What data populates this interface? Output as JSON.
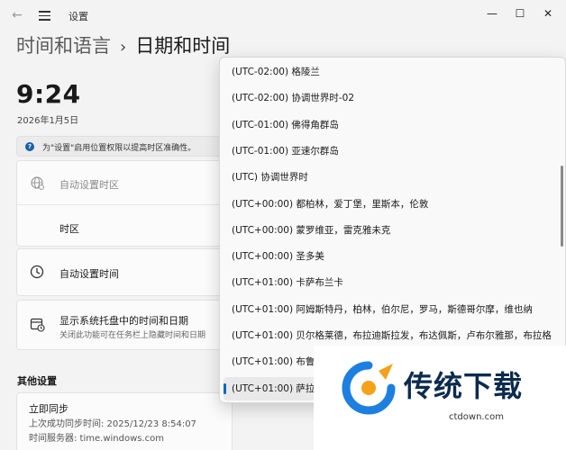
{
  "window": {
    "title": "设置"
  },
  "breadcrumb": {
    "parent": "时间和语言",
    "separator": "›",
    "current": "日期和时间"
  },
  "clock": {
    "time": "9:24",
    "date": "2026年1月5日"
  },
  "infobar": {
    "icon_glyph": "?",
    "text": "为\"设置\"启用位置权限以提高时区准确性。"
  },
  "settings": {
    "auto_timezone": "自动设置时区",
    "timezone": "时区",
    "auto_time": "自动设置时间",
    "tray_title": "显示系统托盘中的时间和日期",
    "tray_sub": "关闭此功能可在任务栏上隐藏时间和日期"
  },
  "other_section": {
    "title": "其他设置"
  },
  "sync": {
    "label": "立即同步",
    "last": "上次成功同步时间: 2025/12/23 8:54:07",
    "server": "时间服务器: time.windows.com"
  },
  "timezone_list": [
    "(UTC-02:00) 格陵兰",
    "(UTC-02:00) 协调世界时-02",
    "(UTC-01:00) 佛得角群岛",
    "(UTC-01:00) 亚速尔群岛",
    "(UTC) 协调世界时",
    "(UTC+00:00) 都柏林，爱丁堡，里斯本，伦敦",
    "(UTC+00:00) 蒙罗维亚，雷克雅未克",
    "(UTC+00:00) 圣多美",
    "(UTC+01:00) 卡萨布兰卡",
    "(UTC+01:00) 阿姆斯特丹，柏林，伯尔尼，罗马，斯德哥尔摩，维也纳",
    "(UTC+01:00) 贝尔格莱德，布拉迪斯拉发，布达佩斯，卢布尔雅那，布拉格",
    "(UTC+01:00) 布鲁塞",
    "(UTC+01:00) 萨拉热"
  ],
  "watermark": {
    "name": "传统下载",
    "url": "ctdown.com"
  },
  "colors": {
    "accent": "#0067c0",
    "background": "#f3f3f3",
    "brand_blue": "#1d7fe0",
    "brand_orange": "#f5a21b"
  }
}
